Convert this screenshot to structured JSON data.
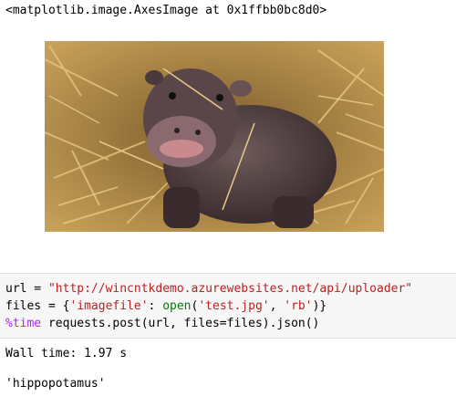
{
  "outputs": {
    "axes_repr": "<matplotlib.image.AxesImage at 0x1ffbb0bc8d0>",
    "wall_time": "Wall time: 1.97 s",
    "result": "'hippopotamus'"
  },
  "code": {
    "line1": {
      "var": "url = ",
      "url": "\"http://wincntkdemo.azurewebsites.net/api/uploader\""
    },
    "line2": {
      "pre": "files = {",
      "key": "'imagefile'",
      "mid": ": ",
      "fn": "open",
      "open_paren": "(",
      "fname": "'test.jpg'",
      "comma": ", ",
      "mode": "'rb'",
      "post": ")}"
    },
    "line3": {
      "magic": "%time",
      "rest": " requests.post(url, files=files).json()"
    }
  },
  "image": {
    "subject": "baby hippopotamus on straw"
  },
  "colors": {
    "string": "#ba2121",
    "builtin": "#008000",
    "magic": "#aa22ff",
    "cell_bg": "#f7f7f7"
  }
}
